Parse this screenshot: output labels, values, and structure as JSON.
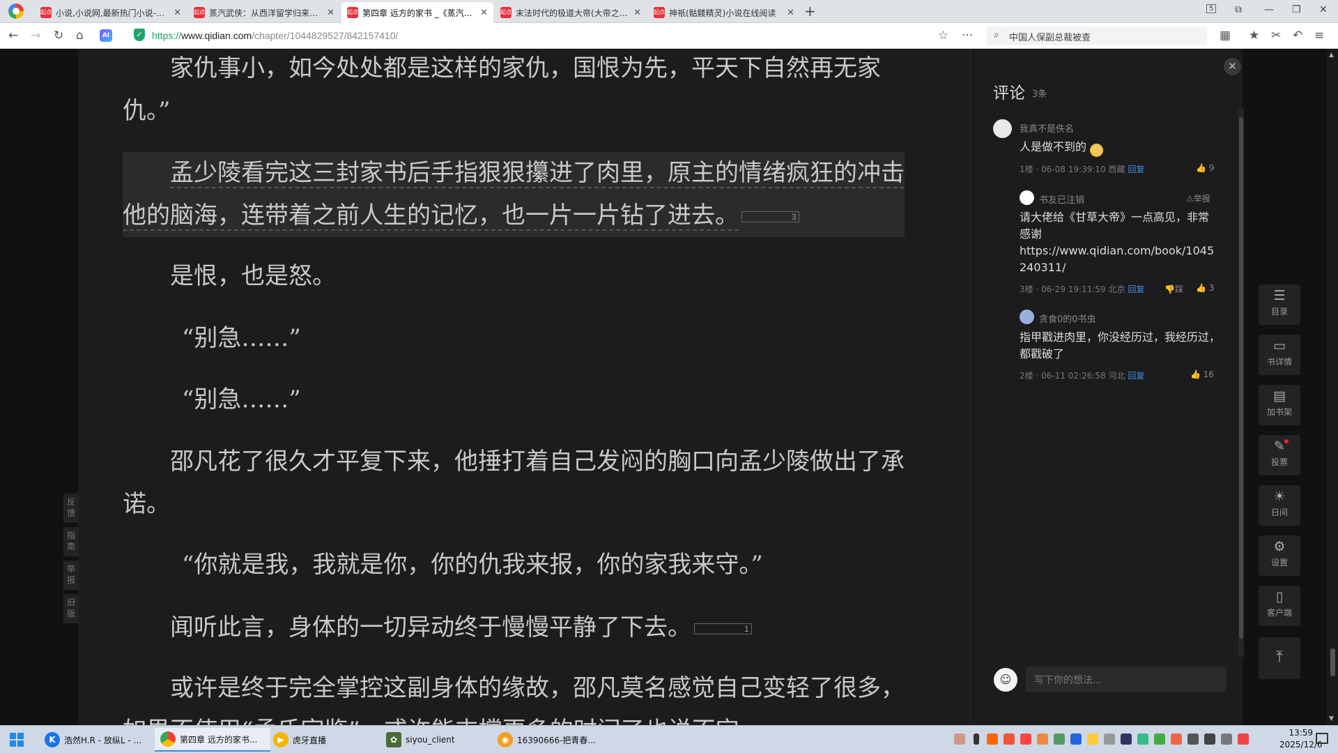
{
  "browser": {
    "tabs": [
      {
        "favicon": "起点",
        "title": "小说,小说网,最新热门小说-起点中文网"
      },
      {
        "favicon": "起点",
        "title": "蒸汽武侠：从西洋留学归来开始"
      },
      {
        "favicon": "起点",
        "title": "第四章 远方的家书 _《蒸汽武侠》"
      },
      {
        "favicon": "起点",
        "title": "末法时代的极道大帝(大帝之资)"
      },
      {
        "favicon": "起点",
        "title": "神祇(骷髅精灵)小说在线阅读"
      }
    ],
    "active_tab_index": 2,
    "new_tab": "+",
    "tab_count_badge": "5",
    "address": {
      "scheme": "https://",
      "host": "www.qidian.com",
      "path": "/chapter/1044829527/842157410/"
    },
    "search_text": "中国人保副总裁被查",
    "ai_label": "AI"
  },
  "chapter": {
    "paragraphs": [
      {
        "text": "家仇事小，如今处处都是这样的家仇，国恨为先，平天下自然再无家仇。”",
        "count": ""
      },
      {
        "text": "孟少陵看完这三封家书后手指狠狠攥进了肉里，原主的情绪疯狂的冲击他的脑海，连带着之前人生的记忆，也一片一片钻了进去。",
        "count": "3"
      },
      {
        "text": "是恨，也是怒。",
        "count": ""
      },
      {
        "text": "“别急……”",
        "count": ""
      },
      {
        "text": "“别急……”",
        "count": ""
      },
      {
        "text": "邵凡花了很久才平复下来，他捶打着自己发闷的胸口向孟少陵做出了承诺。",
        "count": ""
      },
      {
        "text": "“你就是我，我就是你，你的仇我来报，你的家我来守。”",
        "count": ""
      },
      {
        "text": "闻听此言，身体的一切异动终于慢慢平静了下去。",
        "count": "1"
      },
      {
        "text": "或许是终于完全掌控这副身体的缘故，邵凡莫名感觉自己变轻了很多，如果不使用“孟氏宗鉴”，或许能支撑更多的时间了也说不定。",
        "count": ""
      }
    ]
  },
  "left_tools": [
    "反馈",
    "指南",
    "举报",
    "旧版"
  ],
  "comments": {
    "title": "评论",
    "count": "3条",
    "close": "✕",
    "items": [
      {
        "user": "我真不是佚名",
        "text": "人是做不到的",
        "emoji": "😳",
        "meta": "1楼 · 06-08 19:39:10 西藏",
        "reply": "回复",
        "likes": "9",
        "report": "",
        "dislike": ""
      },
      {
        "user": "书友已注销",
        "text": "请大佬给《甘草大帝》一点高见，非常感谢\nhttps://www.qidian.com/book/1045240311/",
        "emoji": "",
        "meta": "3楼 · 06-29 19:11:59 北京",
        "reply": "回复",
        "likes": "3",
        "report": "举报",
        "dislike": "踩"
      },
      {
        "user": "贪食0的0书虫",
        "text": "指甲戳进肉里，你没经历过，我经历过，都戳破了",
        "emoji": "",
        "meta": "2楼 · 06-11 02:26:58 河北",
        "reply": "回复",
        "likes": "16",
        "report": "",
        "dislike": ""
      }
    ],
    "input_placeholder": "写下你的想法..."
  },
  "right_tools": [
    {
      "icon": "list-icon",
      "glyph": "☰",
      "label": "目录"
    },
    {
      "icon": "book-icon",
      "glyph": "📖",
      "label": "书详情"
    },
    {
      "icon": "bookshelf-icon",
      "glyph": "▤",
      "label": "加书架"
    },
    {
      "icon": "vote-icon",
      "glyph": "✎",
      "label": "投票"
    },
    {
      "icon": "sun-icon",
      "glyph": "☀",
      "label": "日间"
    },
    {
      "icon": "settings-icon",
      "glyph": "⚙",
      "label": "设置"
    },
    {
      "icon": "phone-icon",
      "glyph": "▯",
      "label": "客户端"
    }
  ],
  "back_to_top_glyph": "⤒",
  "taskbar": {
    "tasks": [
      {
        "label": "浩然H.R - 放纵L - ...",
        "color": "#1a73e8",
        "glyph": "K"
      },
      {
        "label": "第四章 远方的家书...",
        "color": "#e94235",
        "glyph": "●"
      },
      {
        "label": "虎牙直播",
        "color": "#f5b400",
        "glyph": "▶"
      },
      {
        "label": "siyou_client",
        "color": "#4a6a3a",
        "glyph": "✿"
      },
      {
        "label": "16390666-把青春...",
        "color": "#f0a020",
        "glyph": "◉"
      }
    ],
    "time": "13:59",
    "date": "2025/12/6"
  }
}
